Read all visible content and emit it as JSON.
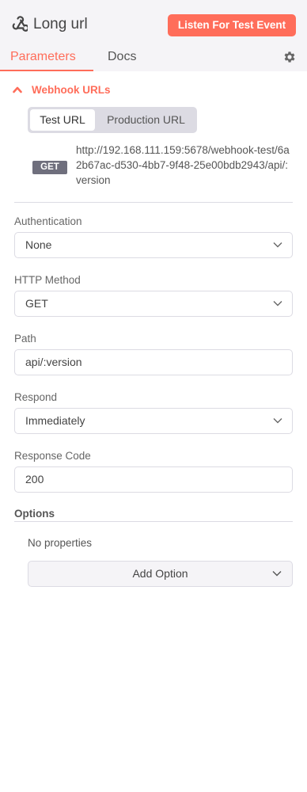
{
  "header": {
    "node_icon": "webhook-icon",
    "title": "Long url",
    "listen_button": "Listen For Test Event",
    "settings_icon": "gear-icon"
  },
  "tabs": [
    {
      "label": "Parameters",
      "active": true
    },
    {
      "label": "Docs",
      "active": false
    }
  ],
  "webhook_urls": {
    "section_label": "Webhook URLs",
    "toggle": {
      "options": [
        "Test URL",
        "Production URL"
      ],
      "selected": "Test URL"
    },
    "method": "GET",
    "url": "http://192.168.111.159:5678/webhook-test/6a2b67ac-d530-4bb7-9f48-25e00bdb2943/api/:version"
  },
  "fields": {
    "authentication": {
      "label": "Authentication",
      "value": "None"
    },
    "http_method": {
      "label": "HTTP Method",
      "value": "GET"
    },
    "path": {
      "label": "Path",
      "value": "api/:version"
    },
    "respond": {
      "label": "Respond",
      "value": "Immediately"
    },
    "response_code": {
      "label": "Response Code",
      "value": "200"
    }
  },
  "options": {
    "title": "Options",
    "empty_text": "No properties",
    "add_button": "Add Option"
  },
  "colors": {
    "accent": "#ff6d5a",
    "badge": "#6f6f7d",
    "header_bg": "#f5f4f7"
  }
}
